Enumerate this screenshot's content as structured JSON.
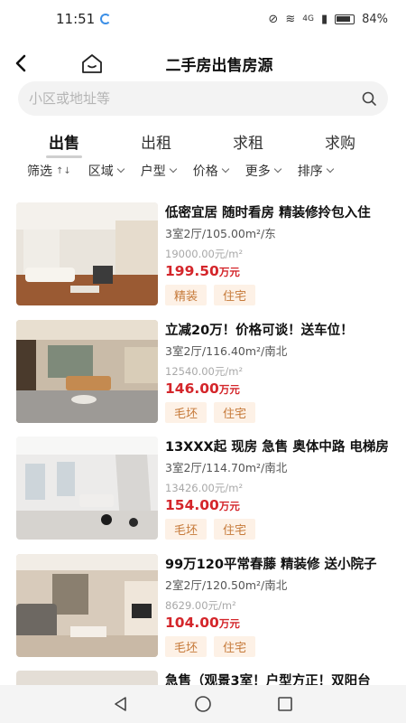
{
  "status_bar": {
    "time": "11:51",
    "network": "4G",
    "battery": "84%"
  },
  "nav": {
    "title": "二手房出售房源"
  },
  "search": {
    "placeholder": "小区或地址等"
  },
  "tabs": [
    {
      "label": "出售",
      "active": true
    },
    {
      "label": "出租",
      "active": false
    },
    {
      "label": "求租",
      "active": false
    },
    {
      "label": "求购",
      "active": false
    }
  ],
  "filters": [
    {
      "label": "筛选",
      "glyph": "↑↓"
    },
    {
      "label": "区域"
    },
    {
      "label": "户型"
    },
    {
      "label": "价格"
    },
    {
      "label": "更多"
    },
    {
      "label": "排序"
    }
  ],
  "listings": [
    {
      "title": "低密宜居 随时看房 精装修拎包入住",
      "spec": "3室2厅/105.00m²/东",
      "unit_price": "19000.00元/m²",
      "price": "199.50",
      "price_unit": "万元",
      "tags": [
        "精装",
        "住宅"
      ]
    },
    {
      "title": "立减20万！价格可谈！送车位！",
      "spec": "3室2厅/116.40m²/南北",
      "unit_price": "12540.00元/m²",
      "price": "146.00",
      "price_unit": "万元",
      "tags": [
        "毛坯",
        "住宅"
      ]
    },
    {
      "title": "13XXX起 现房 急售 奥体中路 电梯房",
      "spec": "3室2厅/114.70m²/南北",
      "unit_price": "13426.00元/m²",
      "price": "154.00",
      "price_unit": "万元",
      "tags": [
        "毛坯",
        "住宅"
      ]
    },
    {
      "title": "99万120平常春藤 精装修 送小院子",
      "spec": "2室2厅/120.50m²/南北",
      "unit_price": "8629.00元/m²",
      "price": "104.00",
      "price_unit": "万元",
      "tags": [
        "毛坯",
        "住宅"
      ]
    },
    {
      "title": "急售（观景3室！户型方正！双阳台",
      "spec": "",
      "unit_price": "",
      "price": "",
      "price_unit": "",
      "tags": []
    }
  ],
  "colors": {
    "price": "#d4262b",
    "tag_text": "#c67a3a",
    "tag_bg": "#fdf1e6",
    "search_bg": "#f3f3f3"
  },
  "icons": {
    "back": "back-arrow-icon",
    "home": "home-icon",
    "search": "search-icon",
    "nav_back": "triangle-back-icon",
    "nav_home": "circle-home-icon",
    "nav_recents": "square-recents-icon"
  }
}
